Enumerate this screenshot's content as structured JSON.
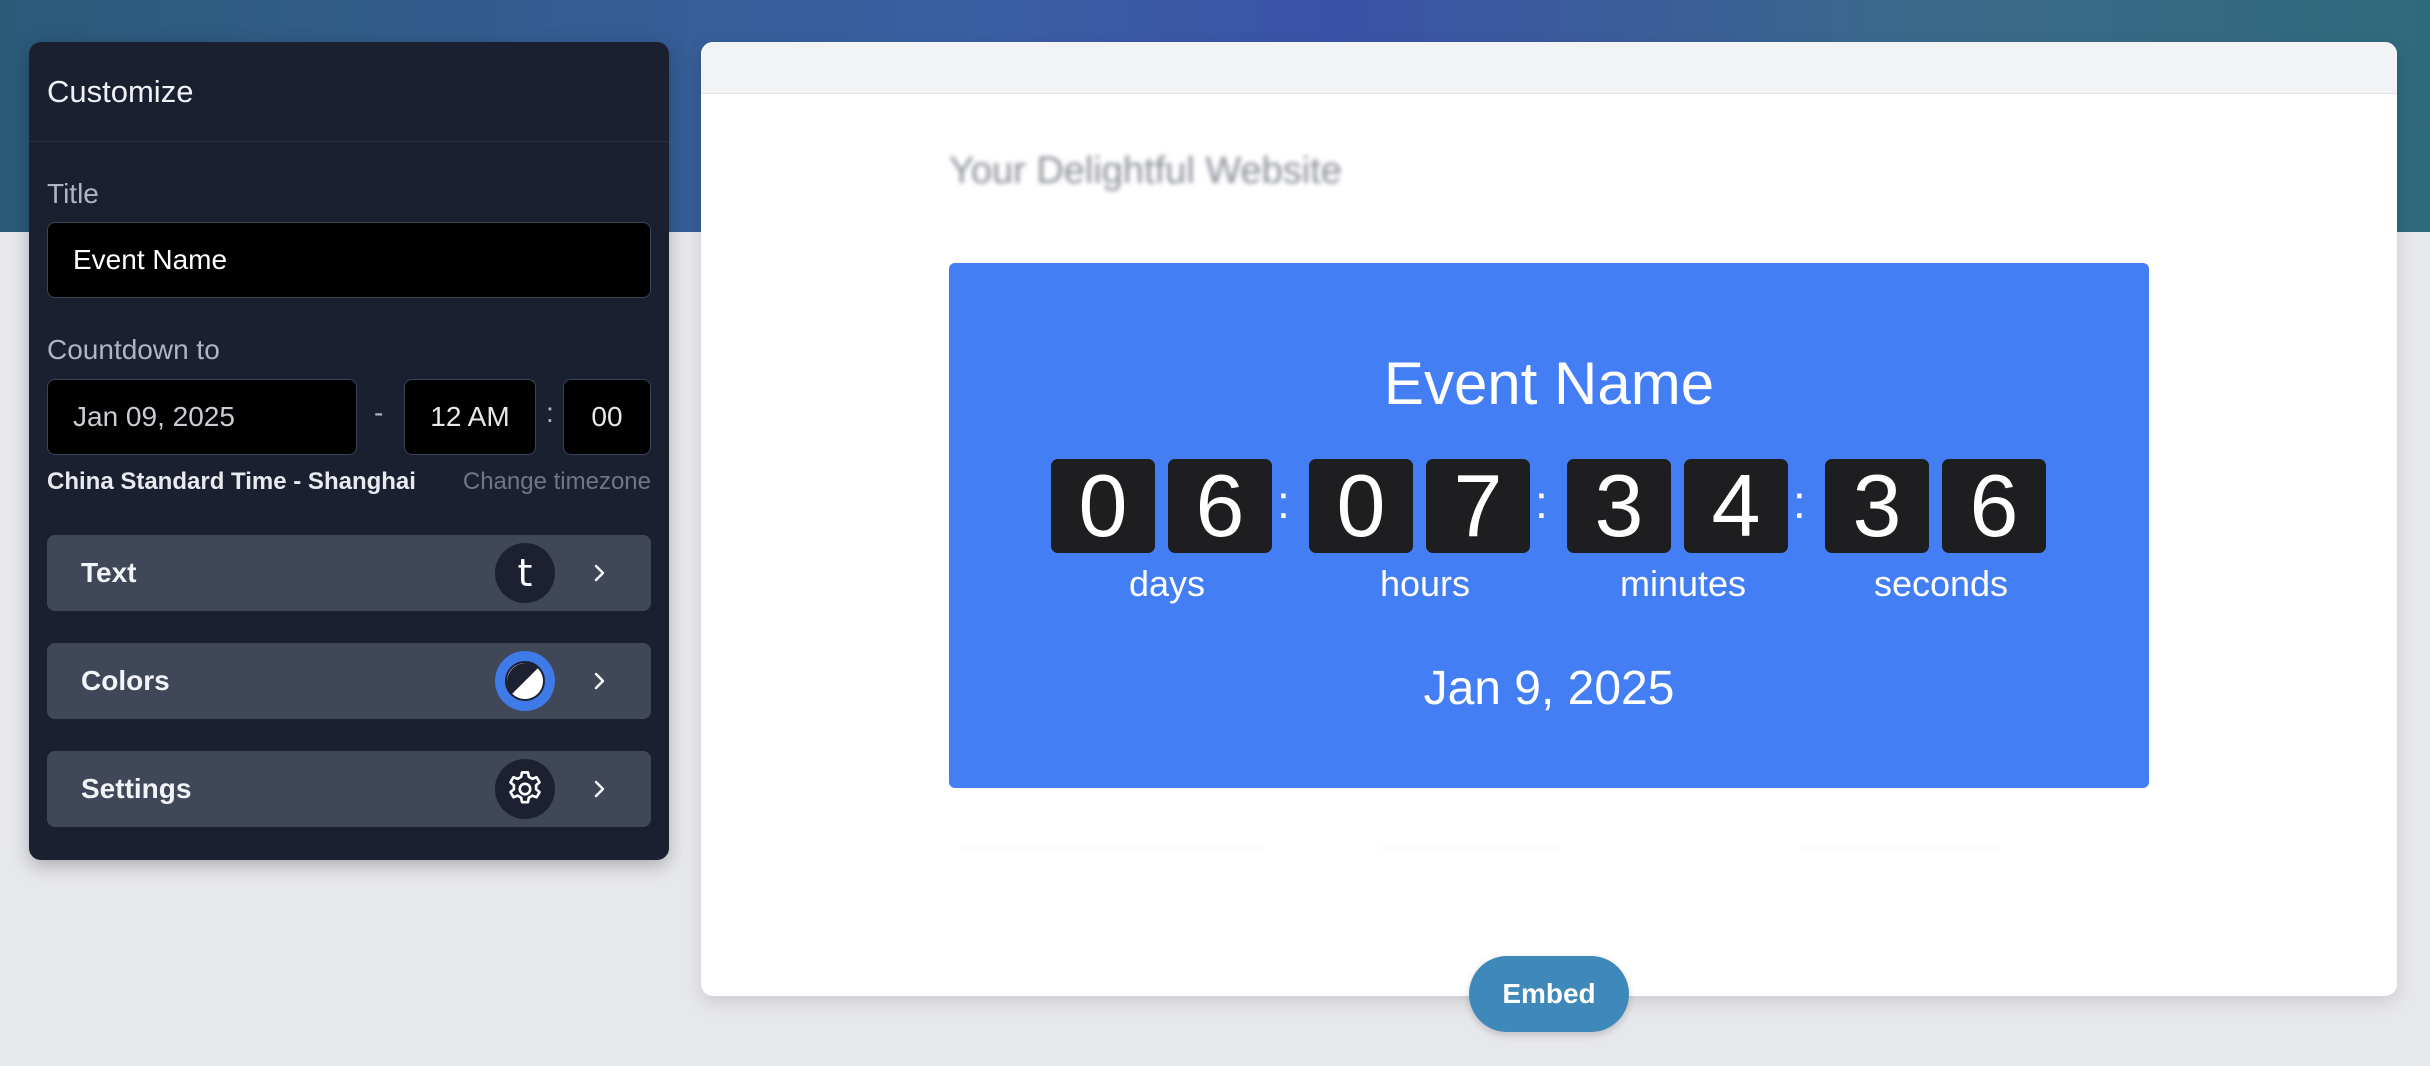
{
  "panel": {
    "title": "Customize",
    "title_label": "Title",
    "title_value": "Event Name",
    "countdown_label": "Countdown to",
    "date_value": "Jan 09, 2025",
    "dash": "-",
    "time_value": "12 AM",
    "colon": ":",
    "minute_value": "00",
    "timezone": "China Standard Time - Shanghai",
    "change_timezone": "Change timezone",
    "sections": [
      {
        "label": "Text",
        "badge": "t",
        "icon": "text-icon"
      },
      {
        "label": "Colors",
        "icon": "contrast-icon"
      },
      {
        "label": "Settings",
        "icon": "gear-icon"
      }
    ]
  },
  "preview": {
    "site_title": "Your Delightful Website",
    "event_title": "Event Name",
    "digits": [
      "0",
      "6",
      "0",
      "7",
      "3",
      "4",
      "3",
      "6"
    ],
    "units": [
      "days",
      "hours",
      "minutes",
      "seconds"
    ],
    "colon": ":",
    "event_date": "Jan 9, 2025",
    "embed_label": "Embed"
  },
  "colors": {
    "panel_bg": "#1b2031",
    "countdown_bg": "#437ef4",
    "digit_bg": "#1e1e20",
    "embed_button": "#3f88ba",
    "accent_ring": "#3f7be8"
  }
}
